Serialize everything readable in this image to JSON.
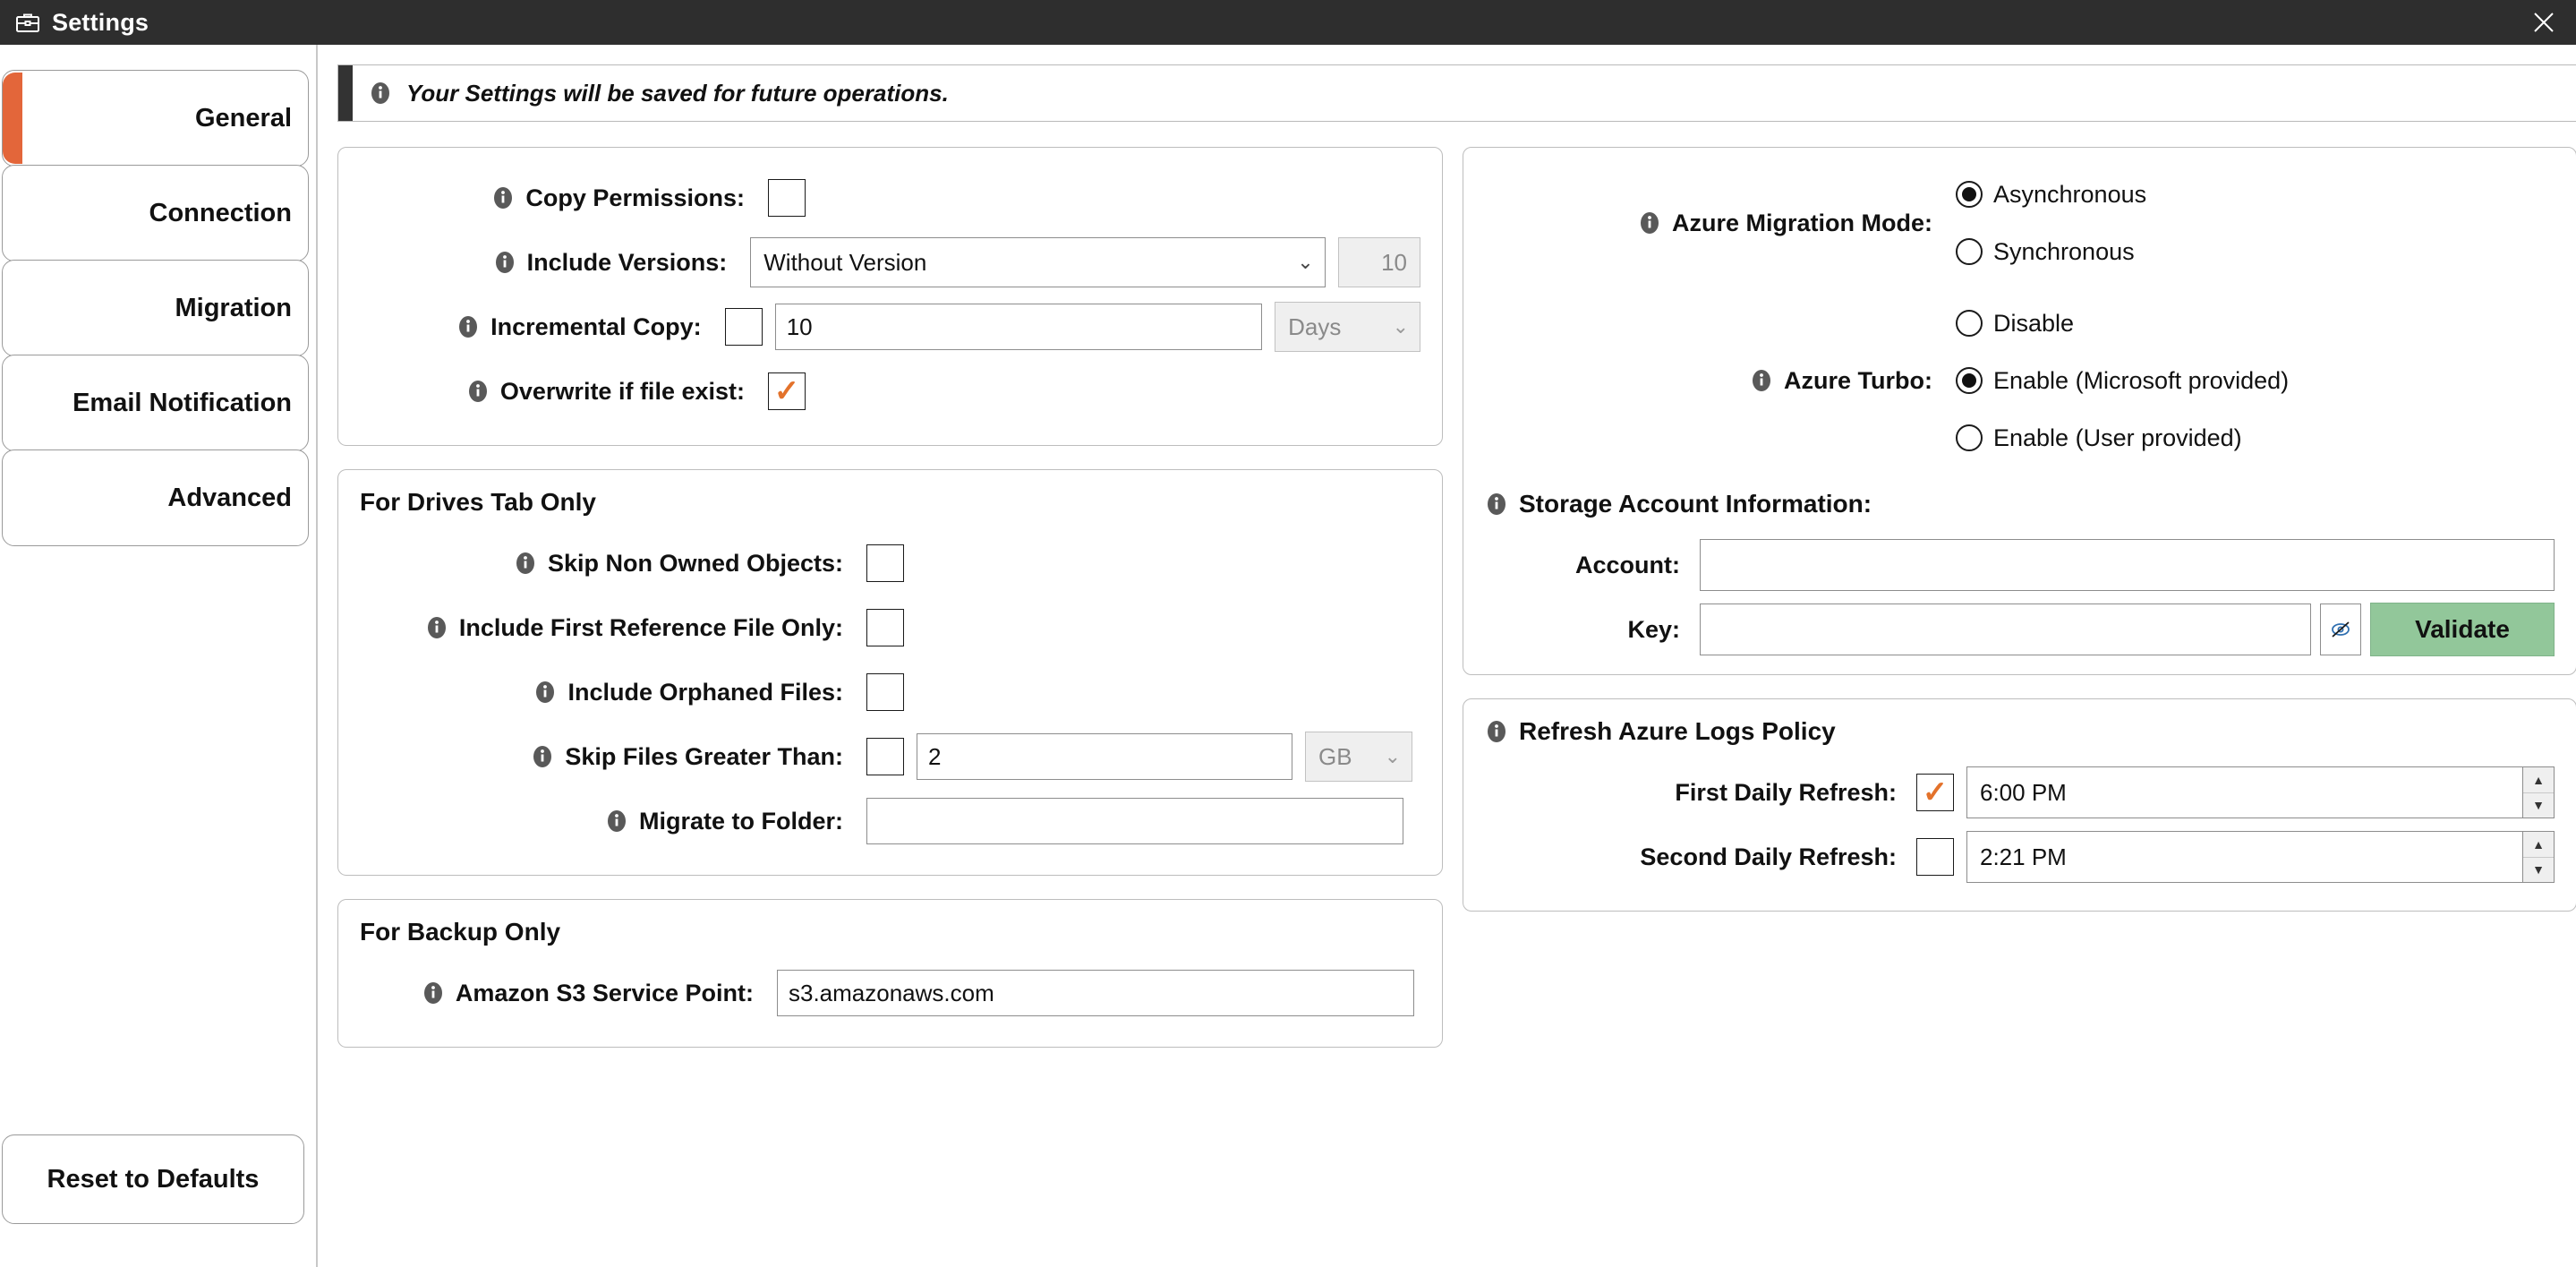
{
  "window": {
    "title": "Settings",
    "icon": "briefcase-icon",
    "close_icon": "close-icon",
    "accent_color": "#e3663a",
    "titlebar_color": "#2e2e2e"
  },
  "sidebar": {
    "tabs": [
      {
        "label": "General",
        "active": true
      },
      {
        "label": "Connection",
        "active": false
      },
      {
        "label": "Migration",
        "active": false
      },
      {
        "label": "Email Notification",
        "active": false
      },
      {
        "label": "Advanced",
        "active": false
      }
    ],
    "reset_label": "Reset to Defaults"
  },
  "banner": {
    "icon": "info-icon",
    "text": "Your Settings will be saved for future operations."
  },
  "general": {
    "copy_permissions": {
      "label": "Copy Permissions:",
      "checked": false
    },
    "include_versions": {
      "label": "Include Versions:",
      "value": "Without Version",
      "options": [
        "Without Version"
      ],
      "count": "10"
    },
    "incremental_copy": {
      "label": "Incremental Copy:",
      "checked": false,
      "value": "10",
      "unit": "Days",
      "unit_options": [
        "Days"
      ]
    },
    "overwrite_if_file_exist": {
      "label": "Overwrite if file exist:",
      "checked": true
    }
  },
  "drives": {
    "title": "For Drives Tab Only",
    "skip_non_owned": {
      "label": "Skip Non Owned Objects:",
      "checked": false
    },
    "include_first_reference": {
      "label": "Include First Reference File Only:",
      "checked": false
    },
    "include_orphaned": {
      "label": "Include Orphaned Files:",
      "checked": false
    },
    "skip_files_greater": {
      "label": "Skip Files Greater Than:",
      "checked": false,
      "value": "2",
      "unit": "GB",
      "unit_options": [
        "GB"
      ]
    },
    "migrate_to_folder": {
      "label": "Migrate to Folder:",
      "value": ""
    }
  },
  "backup": {
    "title": "For Backup Only",
    "s3_service_point": {
      "label": "Amazon S3 Service Point:",
      "value": "s3.amazonaws.com"
    }
  },
  "azure": {
    "migration_mode": {
      "label": "Azure Migration Mode:",
      "selected": "Asynchronous",
      "options": [
        "Asynchronous",
        "Synchronous"
      ]
    },
    "turbo": {
      "label": "Azure Turbo:",
      "selected": "Enable (Microsoft provided)",
      "options": [
        "Disable",
        "Enable (Microsoft provided)",
        "Enable (User provided)"
      ]
    },
    "storage": {
      "title": "Storage Account Information:",
      "account_label": "Account:",
      "account_value": "",
      "key_label": "Key:",
      "key_value": "",
      "eye_icon": "eye-slash-icon",
      "validate_label": "Validate",
      "validate_color": "#92c79a"
    }
  },
  "refresh_policy": {
    "title": "Refresh Azure Logs Policy",
    "first": {
      "label": "First Daily Refresh:",
      "checked": true,
      "time": "6:00 PM"
    },
    "second": {
      "label": "Second Daily Refresh:",
      "checked": false,
      "time": "2:21 PM"
    }
  }
}
